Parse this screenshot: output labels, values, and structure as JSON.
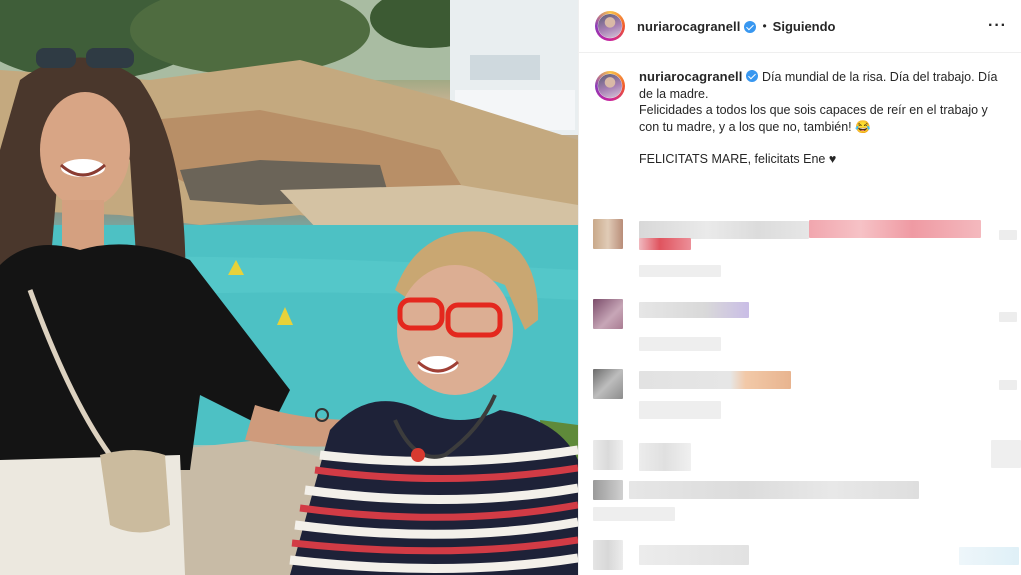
{
  "post": {
    "username": "nuriarocagranell",
    "follow_status": "Siguiendo",
    "separator": "•",
    "more_icon": "···",
    "caption_lines": [
      "Día mundial de la risa. Día del trabajo. Día de la madre.",
      "Felicidades a todos los que sois capaces de reír en el trabajo y con tu madre, y a los que no, también! 😂",
      "FELICITATS MARE, felicitats Ene ♥"
    ]
  },
  "colors": {
    "verified": "#3897f0",
    "text": "#262626",
    "border": "#efefef"
  },
  "icons": [
    "verified-badge-icon",
    "more-options-icon",
    "heart-emoji",
    "laughing-emoji"
  ]
}
